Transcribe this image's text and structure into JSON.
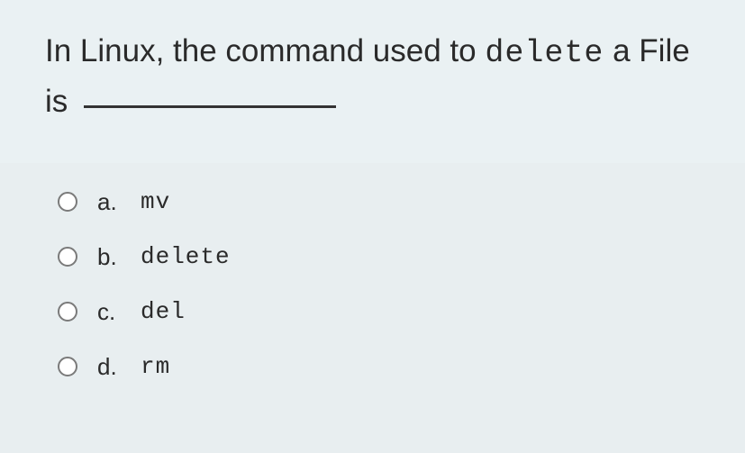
{
  "question": {
    "prefix": "In Linux, the command used to ",
    "mono_word": "delete",
    "suffix": " a File is "
  },
  "options": [
    {
      "letter": "a.",
      "text": "mv"
    },
    {
      "letter": "b.",
      "text": "delete"
    },
    {
      "letter": "c.",
      "text": "del"
    },
    {
      "letter": "d.",
      "text": "rm"
    }
  ]
}
